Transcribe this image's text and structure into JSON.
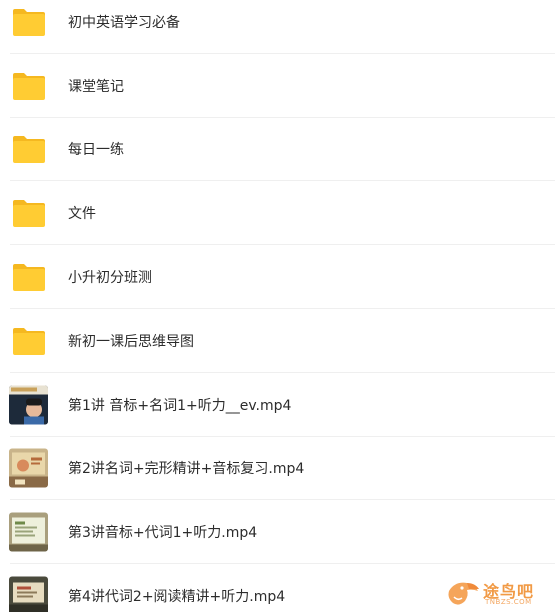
{
  "items": [
    {
      "type": "folder",
      "label": "初中英语学习必备"
    },
    {
      "type": "folder",
      "label": "课堂笔记"
    },
    {
      "type": "folder",
      "label": "每日一练"
    },
    {
      "type": "folder",
      "label": "文件"
    },
    {
      "type": "folder",
      "label": "小升初分班测"
    },
    {
      "type": "folder",
      "label": "新初一课后思维导图"
    },
    {
      "type": "video",
      "label": "第1讲 音标+名词1+听力__ev.mp4"
    },
    {
      "type": "video",
      "label": "第2讲名词+完形精讲+音标复习.mp4"
    },
    {
      "type": "video",
      "label": "第3讲音标+代词1+听力.mp4"
    },
    {
      "type": "video",
      "label": "第4讲代词2+阅读精讲+听力.mp4"
    }
  ],
  "colors": {
    "folder": "#ffcc33",
    "folder_tab": "#f5b820",
    "separator": "#efefef",
    "text": "#2c2c2c",
    "watermark": "#f19a45"
  },
  "watermark": {
    "icon": "toucan-logo-icon",
    "title": "途鸟吧",
    "subtitle": "TNBZS.COM"
  }
}
